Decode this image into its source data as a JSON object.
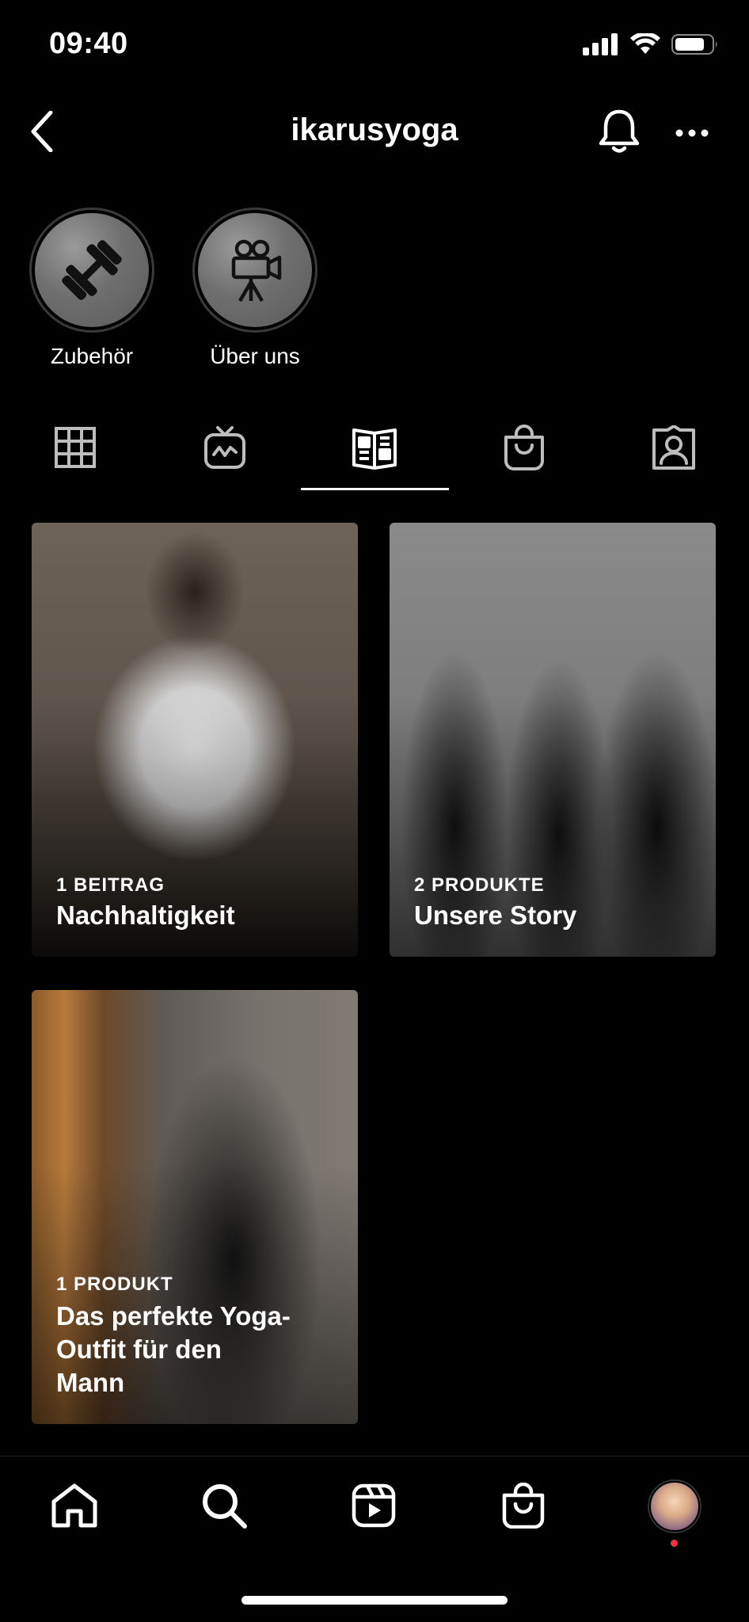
{
  "status_bar": {
    "time": "09:40"
  },
  "header": {
    "username": "ikarusyoga"
  },
  "highlights": [
    {
      "label": "Zubehör",
      "icon": "dumbbell-icon"
    },
    {
      "label": "Über uns",
      "icon": "movie-camera-icon"
    }
  ],
  "tabs": [
    {
      "icon": "grid-icon",
      "active": false
    },
    {
      "icon": "igtv-icon",
      "active": false
    },
    {
      "icon": "guides-icon",
      "active": true
    },
    {
      "icon": "shop-icon",
      "active": false
    },
    {
      "icon": "tagged-icon",
      "active": false
    }
  ],
  "guides": [
    {
      "subtitle": "1 BEITRAG",
      "title": "Nachhaltigkeit"
    },
    {
      "subtitle": "2 PRODUKTE",
      "title": "Unsere Story"
    },
    {
      "subtitle": "1 PRODUKT",
      "title": "Das perfekte Yoga-Outfit für den Mann"
    }
  ],
  "bottom_nav": [
    {
      "icon": "home-icon"
    },
    {
      "icon": "search-icon"
    },
    {
      "icon": "reels-icon"
    },
    {
      "icon": "shop-bag-icon"
    },
    {
      "icon": "profile-avatar"
    }
  ],
  "colors": {
    "background": "#000000",
    "text": "#ffffff",
    "notification": "#ff3040"
  }
}
